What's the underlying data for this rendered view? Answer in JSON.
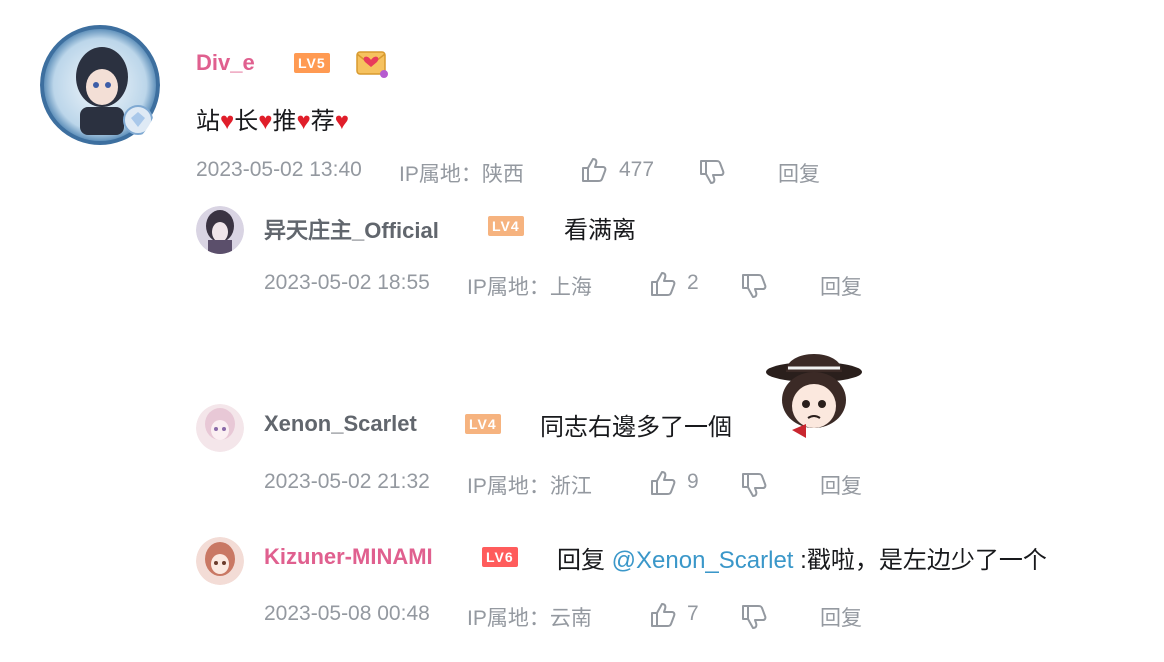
{
  "comments": [
    {
      "user": "Div_e",
      "level": "LV5",
      "content_parts": [
        "站",
        "❤️",
        "长",
        "❤️",
        "推",
        "❤️",
        "荐",
        "❤️"
      ],
      "time": "2023-05-02 13:40",
      "ip": "IP属地：陕西",
      "likes": "477",
      "reply_label": "回复"
    },
    {
      "user": "异天庄主_Official",
      "level": "LV4",
      "content": "看满离",
      "time": "2023-05-02 18:55",
      "ip": "IP属地：上海",
      "likes": "2",
      "reply_label": "回复"
    },
    {
      "user": "Xenon_Scarlet",
      "level": "LV4",
      "content": "同志右邊多了一個",
      "time": "2023-05-02 21:32",
      "ip": "IP属地：浙江",
      "likes": "9",
      "reply_label": "回复"
    },
    {
      "user": "Kizuner-MINAMI",
      "level": "LV6",
      "content_prefix": "回复",
      "mention": "@Xenon_Scarlet",
      "content_suffix": ":戳啦，是左边少了一个",
      "time": "2023-05-08 00:48",
      "ip": "IP属地：云南",
      "likes": "7",
      "reply_label": "回复"
    }
  ],
  "colors": {
    "vip_name": "#e0608f",
    "normal_name": "#61666d",
    "meta": "#9499a0",
    "mention": "#3a97c9"
  },
  "icons": [
    "thumb-up-icon",
    "thumb-down-icon",
    "envelope-heart-badge-icon",
    "sticker-image"
  ]
}
